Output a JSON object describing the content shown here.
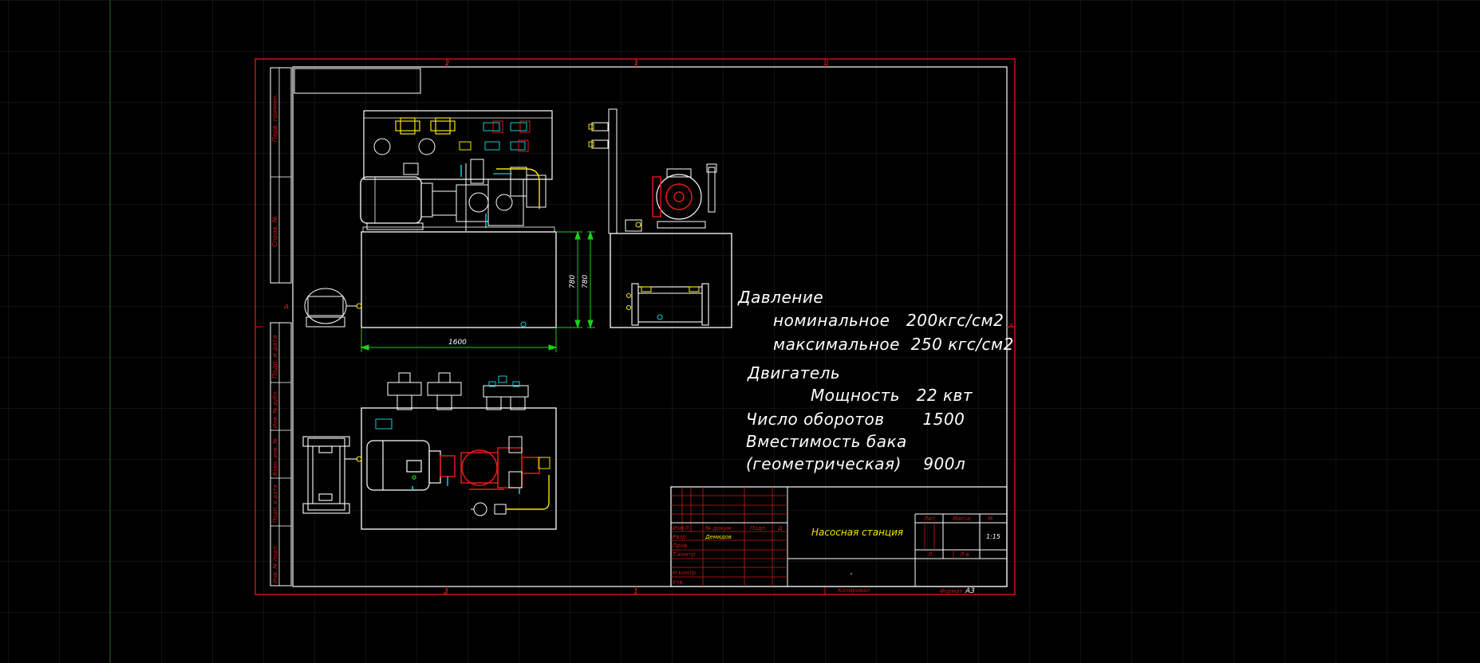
{
  "colors": {
    "background": "#000000",
    "grid": "#1f2a1f",
    "frame": "#d01818",
    "lines": "#ffffff",
    "dimension": "#19d219",
    "highlight_yellow": "#f5e400",
    "accent_red": "#e01a1a",
    "accent_cyan": "#19c8d2"
  },
  "drawing": {
    "zone_marks": {
      "top_left": "2",
      "top_mid": "1",
      "top_right": "1",
      "bottom_left": "2",
      "bottom_mid": "1",
      "side_left": "A",
      "side_right": "A"
    },
    "dimensions": {
      "width": "1600",
      "height_a": "780",
      "height_b": "780"
    },
    "side_stamps": [
      "Перв. примен.",
      "Справ. №",
      "Подп. и дата",
      "Инв. № дубл.",
      "Взам. инв. №",
      "Подп. и дата",
      "Инв. № подл."
    ]
  },
  "specs": {
    "pressure_label": "Давление",
    "pressure_nominal": "номинальное   200кгс/см2",
    "pressure_max": "максимальное  250 кгс/см2",
    "engine_label": "Двигатель",
    "power": "Мощность   22 квт",
    "rpm": "Число оборотов       1500",
    "tank_label": "Вместимость бака",
    "tank_geom": "(геометрическая)    900л"
  },
  "title_block": {
    "header_cols": [
      "Изм",
      "Л.",
      "№ докум.",
      "Подп.",
      "Д"
    ],
    "row_labels": [
      "Разр.",
      "Пров.",
      "Т.контр.",
      "",
      "Н.контр.",
      "Утв."
    ],
    "developer": "Демидов",
    "title": "Насосная станция",
    "lit_header": "Лит.",
    "mass_header": "Масса",
    "scale_header": "М.",
    "scale_value": "1:15",
    "sheet_label": "Л.",
    "sheets_label": "Л-в",
    "copied_by": "Копировал",
    "format_label": "Формат",
    "format_value": "А3"
  }
}
